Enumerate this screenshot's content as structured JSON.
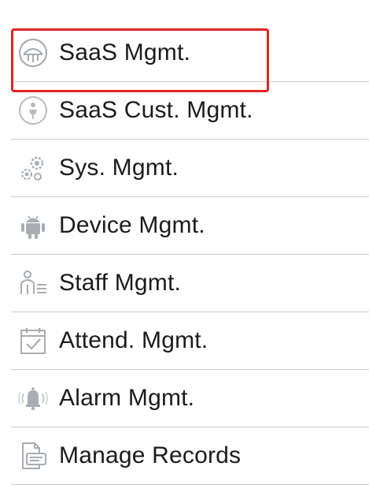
{
  "menu": {
    "items": [
      {
        "label": "SaaS Mgmt.",
        "icon": "saas-icon"
      },
      {
        "label": "SaaS Cust. Mgmt.",
        "icon": "customer-icon"
      },
      {
        "label": "Sys. Mgmt.",
        "icon": "gears-icon"
      },
      {
        "label": "Device Mgmt.",
        "icon": "android-icon"
      },
      {
        "label": "Staff Mgmt.",
        "icon": "staff-icon"
      },
      {
        "label": "Attend. Mgmt.",
        "icon": "calendar-check-icon"
      },
      {
        "label": "Alarm Mgmt.",
        "icon": "alarm-bell-icon"
      },
      {
        "label": "Manage Records",
        "icon": "records-icon"
      }
    ],
    "highlight_color": "#e02424",
    "icon_color": "#a9adb1",
    "divider_color": "#c9ccd0"
  }
}
